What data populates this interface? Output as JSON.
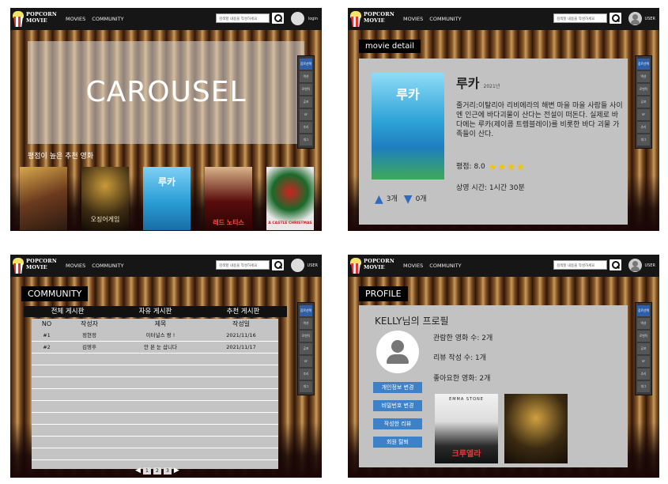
{
  "header": {
    "brand_line1": "POPCORN",
    "brand_line2": "MOVIE",
    "nav_movies": "MOVIES",
    "nav_community": "COMMUNITY",
    "search_placeholder": "검색할 내용을 작성하세요",
    "login": "login",
    "user": "USER"
  },
  "side_menu": [
    "장르선택",
    "액션",
    "로맨틱",
    "공포",
    "SF",
    "추리",
    "개그"
  ],
  "home": {
    "carousel": "CAROUSEL",
    "recommend_title": "평점이 높은 추천 영화",
    "posters": [
      {
        "title": "",
        "color": "#6b3a1e"
      },
      {
        "title": "오징어게임",
        "color": "#3a2a12"
      },
      {
        "title": "루카",
        "color": "#2b9ed6"
      },
      {
        "title": "레드 노티스",
        "color": "#5a0c0c"
      },
      {
        "title": "A CASTLE CHRISTMAS",
        "color": "#e8e8e8"
      }
    ]
  },
  "detail": {
    "section": "movie detail",
    "title": "루카",
    "year": "2021년",
    "poster_title": "루카",
    "synopsis": "줄거리:이탈리아 리비에라의 해변 마을 마을 사람들 사이엔 인근에 바다괴물이 산다는 전설이 떠돈다. 실제로 바다에는 루카(제이콥 트렘블레이)를 비롯한 바다 괴물 가족들이 산다.",
    "rating_label": "평점: 8.0",
    "stars": "★★★★",
    "runtime": "상영 시간: 1시간 30분",
    "likes": "3개",
    "dislikes": "0개"
  },
  "community": {
    "section": "COMMUNITY",
    "tabs": [
      "전체 게시판",
      "자유 게시판",
      "추천 게시판"
    ],
    "columns": [
      "NO",
      "작성자",
      "제목",
      "작성일"
    ],
    "rows": [
      [
        "#1",
        "정현정",
        "이터널스 짱 !",
        "2021/11/16"
      ],
      [
        "#2",
        "김영후",
        "안 본 눈 삽니다",
        "2021/11/17"
      ]
    ],
    "pages": [
      "1",
      "2",
      "3"
    ],
    "prev": "◀",
    "next": "▶"
  },
  "profile": {
    "section": "PROFILE",
    "greeting": "KELLY님의 프로필",
    "watched": "관람한 영화 수: 2개",
    "reviews": "리뷰 작성 수: 1개",
    "liked": "좋아요한 영화: 2개",
    "buttons": [
      "개인정보 변경",
      "비밀번호 변경",
      "작성한 리뷰",
      "회원 탈퇴"
    ],
    "liked_posters": [
      {
        "title": "크루엘라",
        "top": "EMMA STONE",
        "color": "#e9e9e9"
      },
      {
        "title": "",
        "color": "#3a2a12"
      }
    ]
  }
}
